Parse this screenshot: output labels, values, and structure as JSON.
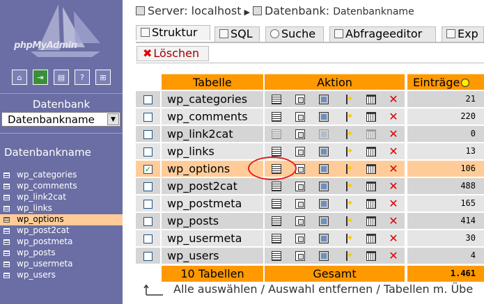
{
  "left": {
    "logo_text": "phpMyAdmin",
    "nav_icons": [
      "home-icon",
      "exit-icon",
      "sql-window-icon",
      "help-icon",
      "query-icon"
    ],
    "db_label": "Datenbank",
    "db_select_value": "Datenbankname",
    "db_name": "Datenbankname",
    "tables": [
      "wp_categories",
      "wp_comments",
      "wp_link2cat",
      "wp_links",
      "wp_options",
      "wp_post2cat",
      "wp_postmeta",
      "wp_posts",
      "wp_usermeta",
      "wp_users"
    ],
    "selected_table": "wp_options"
  },
  "breadcrumb": {
    "server_label": "Server:",
    "server_value": "localhost",
    "db_label": "Datenbank:",
    "db_value": "Datenbankname"
  },
  "tabs": {
    "struktur": "Struktur",
    "sql": "SQL",
    "suche": "Suche",
    "abfrage": "Abfrageeditor",
    "export": "Exp",
    "loeschen": "Löschen"
  },
  "table": {
    "headers": {
      "tabelle": "Tabelle",
      "aktion": "Aktion",
      "eintraege": "Einträge"
    },
    "rows": [
      {
        "name": "wp_categories",
        "count": "21",
        "checked": false
      },
      {
        "name": "wp_comments",
        "count": "220",
        "checked": false
      },
      {
        "name": "wp_link2cat",
        "count": "0",
        "checked": false
      },
      {
        "name": "wp_links",
        "count": "13",
        "checked": false
      },
      {
        "name": "wp_options",
        "count": "106",
        "checked": true
      },
      {
        "name": "wp_post2cat",
        "count": "488",
        "checked": false
      },
      {
        "name": "wp_postmeta",
        "count": "165",
        "checked": false
      },
      {
        "name": "wp_posts",
        "count": "414",
        "checked": false
      },
      {
        "name": "wp_usermeta",
        "count": "30",
        "checked": false
      },
      {
        "name": "wp_users",
        "count": "4",
        "checked": false
      }
    ],
    "action_icons": [
      "browse-icon",
      "select-icon",
      "insert-icon",
      "properties-icon",
      "empty-icon",
      "drop-icon"
    ],
    "footer": {
      "tables": "10 Tabellen",
      "total_label": "Gesamt",
      "total": "1.461"
    }
  },
  "selection": {
    "all": "Alle auswählen",
    "sep": "/",
    "none": "Auswahl entfernen",
    "overhead": "Tabellen m. Übe"
  },
  "colors": {
    "sidebar": "#6b6ea4",
    "header_orange": "#ff9900",
    "row_highlight": "#ffcc99",
    "marker_red": "#e02020"
  }
}
